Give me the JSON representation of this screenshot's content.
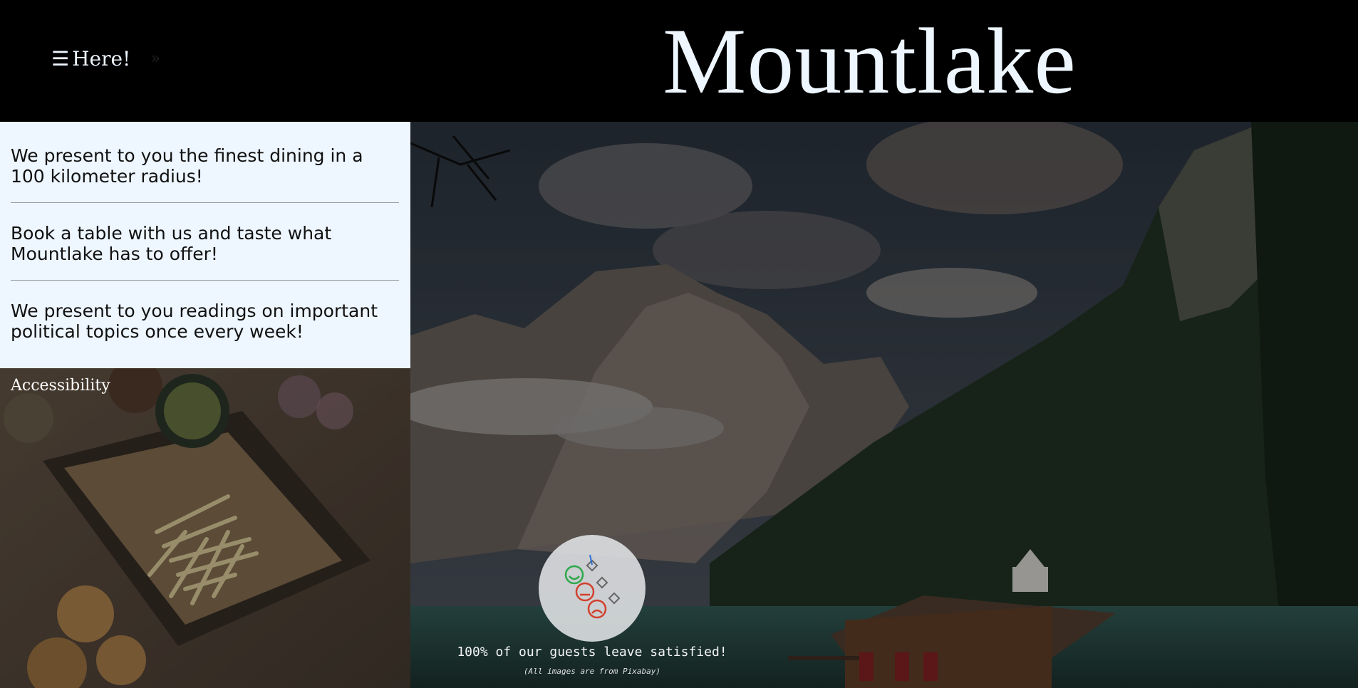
{
  "header": {
    "menu_icon": "☰",
    "menu_label": "Here!",
    "menu_arrow": "»",
    "title": "Mountlake"
  },
  "notes": [
    {
      "text": "We present to you the finest dining in a 100 kilometer radius!"
    },
    {
      "text": "Book a table with us and taste what Mountlake has to offer!"
    },
    {
      "text": "We present to you readings on important political topics once every week!"
    }
  ],
  "accessibility_label": "Accessibility",
  "hero": {
    "satisfaction_text": "100% of our guests leave satisfied!",
    "credit_text": "(All images are from Pixabay)"
  },
  "colors": {
    "header_bg": "#000000",
    "notes_bg": "#eef6ff",
    "title_color": "#eef6ff"
  }
}
